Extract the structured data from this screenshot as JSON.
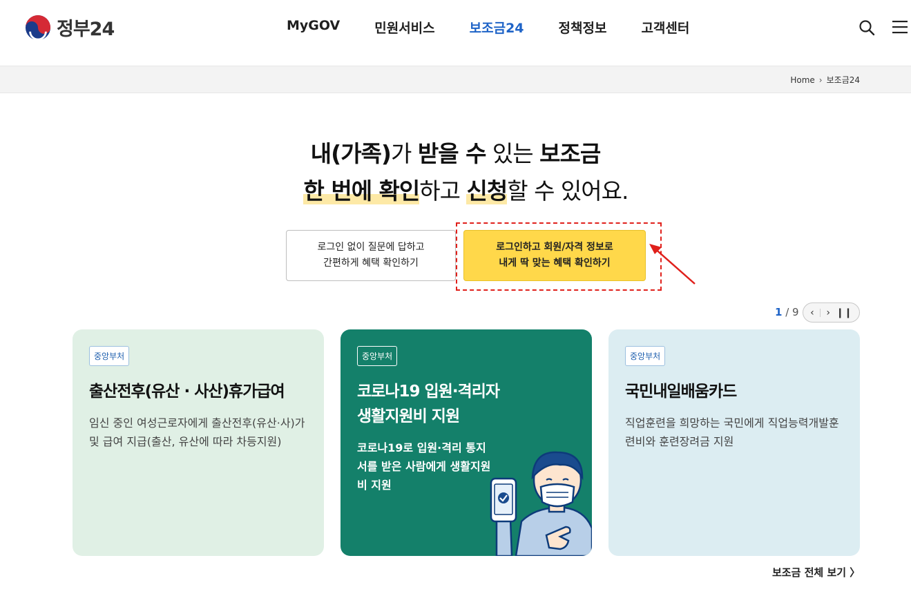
{
  "header": {
    "logo_text": "정부24",
    "nav": [
      "MyGOV",
      "민원서비스",
      "보조금24",
      "정책정보",
      "고객센터"
    ],
    "active_nav": "보조금24",
    "icons": [
      "search-icon",
      "menu-icon"
    ]
  },
  "breadcrumb": {
    "home": "Home",
    "current": "보조금24"
  },
  "hero": {
    "l1_a": "내(가족)",
    "l1_b": "가 ",
    "l1_c": "받을 수",
    "l1_d": " 있는 ",
    "l1_e": "보조금",
    "l2_a": "한 번에 확인",
    "l2_b": "하고 ",
    "l2_c": "신청",
    "l2_d": "할 수 있어요."
  },
  "buttons": {
    "guest_line1": "로그인 없이 질문에 답하고",
    "guest_line2": "간편하게 혜택 확인하기",
    "login_line1": "로그인하고 회원/자격 정보로",
    "login_line2": "내게 딱 맞는 혜택 확인하기"
  },
  "pager": {
    "current": "1",
    "total": "/ 9"
  },
  "cards": [
    {
      "badge": "중앙부처",
      "title": "출산전후(유산 · 사산)휴가급여",
      "desc": "임신 중인 여성근로자에게 출산전후(유산·사)가 및 급여 지급(출산, 유산에 따라 차등지원)"
    },
    {
      "badge": "중앙부처",
      "title_l1": "코로나19 입원·격리자",
      "title_l2": "생활지원비 지원",
      "desc": "코로나19로 입원·격리 통지서를 받은 사람에게 생활지원비 지원"
    },
    {
      "badge": "중앙부처",
      "title": "국민내일배움카드",
      "desc": "직업훈련을 희망하는 국민에게 직업능력개발훈련비와 훈련장려금 지원"
    }
  ],
  "view_all": "보조금 전체 보기 〉",
  "colors": {
    "accent_blue": "#1e63c7",
    "login_yellow": "#ffd84a",
    "card_green_light": "#e0f0e5",
    "card_green_dark": "#14806a",
    "card_blue_light": "#dcedf2",
    "annotation_red": "#e0201b"
  }
}
